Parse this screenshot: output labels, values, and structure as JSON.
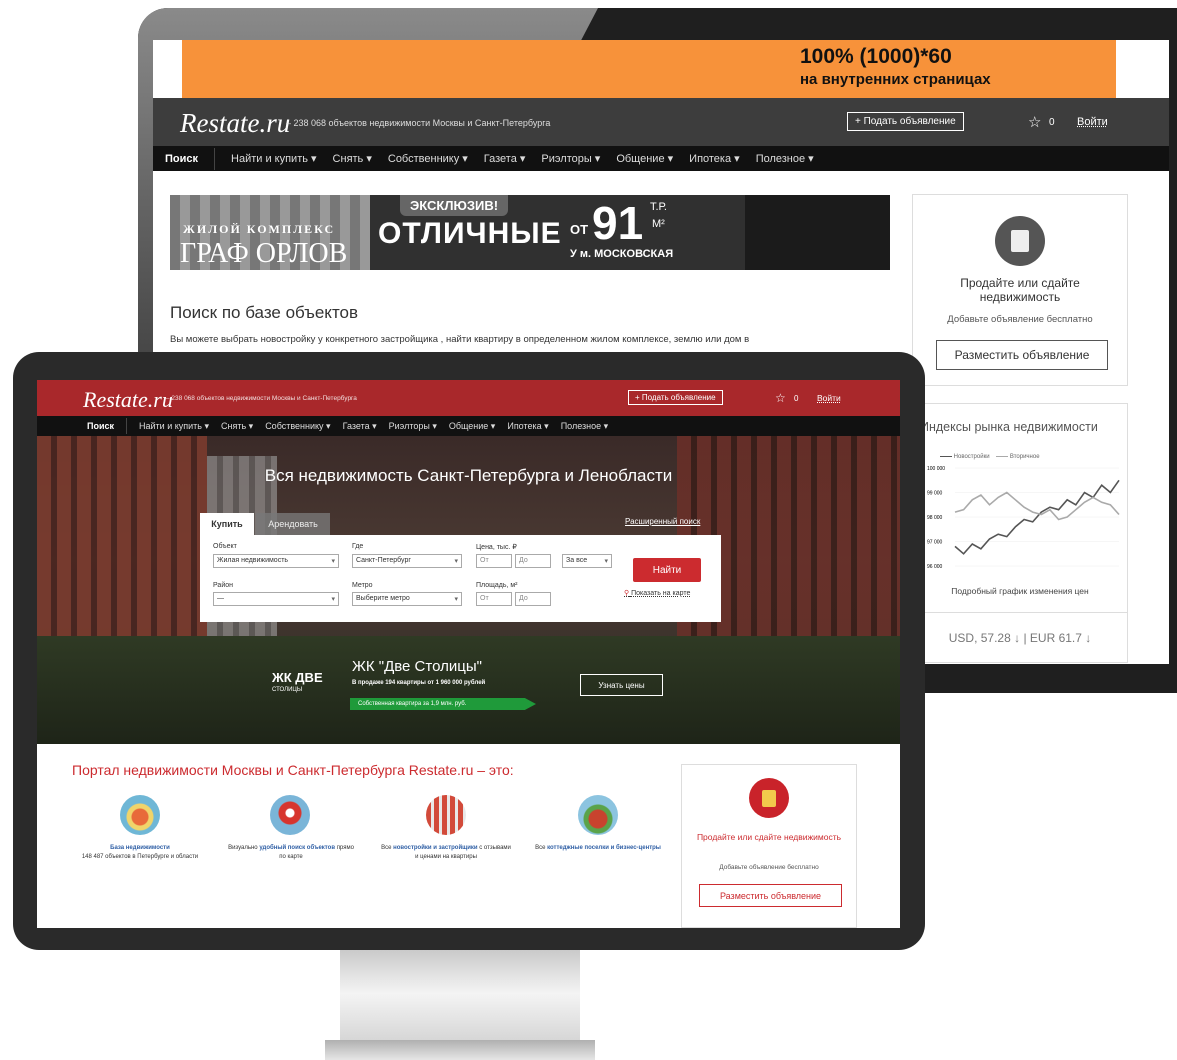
{
  "ad": {
    "line1": "100% (1000)*60",
    "line2": "на внутренних страницах"
  },
  "header": {
    "logo": "Restate.ru",
    "tagline_back": "– 238 068 объектов недвижимости Москвы и Санкт-Петербурга",
    "tagline_front": "– 238 068 объектов недвижимости Москвы и Санкт-Петербурга",
    "post_button": "+ Подать объявление",
    "favorites_count": "0",
    "login": "Войти"
  },
  "nav": [
    "Поиск",
    "Найти и купить ▾",
    "Снять ▾",
    "Собственнику ▾",
    "Газета ▾",
    "Риэлторы ▾",
    "Общение ▾",
    "Ипотека ▾",
    "Полезное ▾"
  ],
  "banner": {
    "exclusive": "ЭКСКЛЮЗИВ!",
    "brand_top": "ЖИЛОЙ КОМПЛЕКС",
    "brand": "ГРАФ ОРЛОВ",
    "main": "ОТЛИЧНЫЕ",
    "from": "ОТ",
    "price": "91",
    "unit_top": "Т.Р.",
    "unit_bottom": "М²",
    "address": "У м. МОСКОВСКАЯ"
  },
  "back_page": {
    "search_title": "Поиск по базе объектов",
    "search_text": "Вы можете выбрать новостройку у конкретного застройщика , найти квартиру в определенном жилом комплексе, землю или дом в"
  },
  "sell_box": {
    "title": "Продайте или сдайте недвижимость",
    "subtitle": "Добавьте объявление бесплатно",
    "button": "Разместить объявление"
  },
  "market": {
    "title": "Индексы рынка недвижимости",
    "legend_new": "Новостройки",
    "legend_secondary": "Вторичное",
    "y_ticks": [
      "100 000",
      "99 000",
      "98 000",
      "97 000",
      "96 000"
    ],
    "link": "Подробный график изменения цен",
    "usd": "USD, 57.28 ↓",
    "eur": "EUR 61.7 ↓"
  },
  "chart_data": {
    "type": "line",
    "title": "Индексы рынка недвижимости",
    "ylim": [
      96000,
      100000
    ],
    "series": [
      {
        "name": "Новостройки",
        "values": [
          96800,
          96500,
          96900,
          96700,
          97100,
          97300,
          97200,
          97600,
          97900,
          97800,
          98200,
          98400,
          98300,
          98700,
          98500,
          99000,
          98800,
          99300,
          99000,
          99500
        ]
      },
      {
        "name": "Вторичное",
        "values": [
          98200,
          98300,
          98700,
          98900,
          98500,
          98800,
          99000,
          98700,
          98400,
          98200,
          98100,
          98300,
          97900,
          98000,
          98300,
          98600,
          98800,
          98600,
          98500,
          98100
        ]
      }
    ]
  },
  "hero": {
    "title": "Вся недвижимость Санкт-Петербурга и Ленобласти",
    "tab_buy": "Купить",
    "tab_rent": "Арендовать",
    "advanced": "Расширенный поиск",
    "labels": {
      "object": "Объект",
      "where": "Где",
      "price": "Цена, тыс. ₽",
      "district": "Район",
      "metro": "Метро",
      "area": "Площадь, м²"
    },
    "values": {
      "object": "Жилая недвижимость",
      "where": "Санкт-Петербург",
      "price_from": "От",
      "price_to": "До",
      "price_period": "За все",
      "district": "—",
      "metro": "Выберите метро",
      "area_from": "От",
      "area_to": "До"
    },
    "find": "Найти",
    "map_link": "Показать на карте"
  },
  "promo": {
    "logo_top": "ЖК ДВЕ",
    "logo_bottom": "СТОЛИЦЫ",
    "name": "ЖК \"Две Столицы\"",
    "sub": "В продаже 194 квартиры от 1 960 000 рублей",
    "ribbon": "Собственная квартира за 1,9 млн. руб.",
    "button": "Узнать цены"
  },
  "portal": {
    "title": "Портал недвижимости Москвы и Санкт-Петербурга Restate.ru – это:",
    "features": [
      {
        "highlight": "База недвижимости",
        "text": "148 487 объектов в Петербурге и области"
      },
      {
        "text": "Визуально",
        "highlight": "удобный поиск объектов",
        "text2": "прямо по карте"
      },
      {
        "text": "Все",
        "highlight": "новостройки и застройщики",
        "text2": "с отзывами и ценами на квартиры"
      },
      {
        "text": "Все",
        "highlight": "коттеджные поселки и бизнес-центры"
      }
    ]
  },
  "colors": {
    "accent": "#cc2b2f",
    "header_dark": "#3d3d3d",
    "ad_orange": "#f7923a",
    "ribbon_green": "#1f9a3a"
  }
}
